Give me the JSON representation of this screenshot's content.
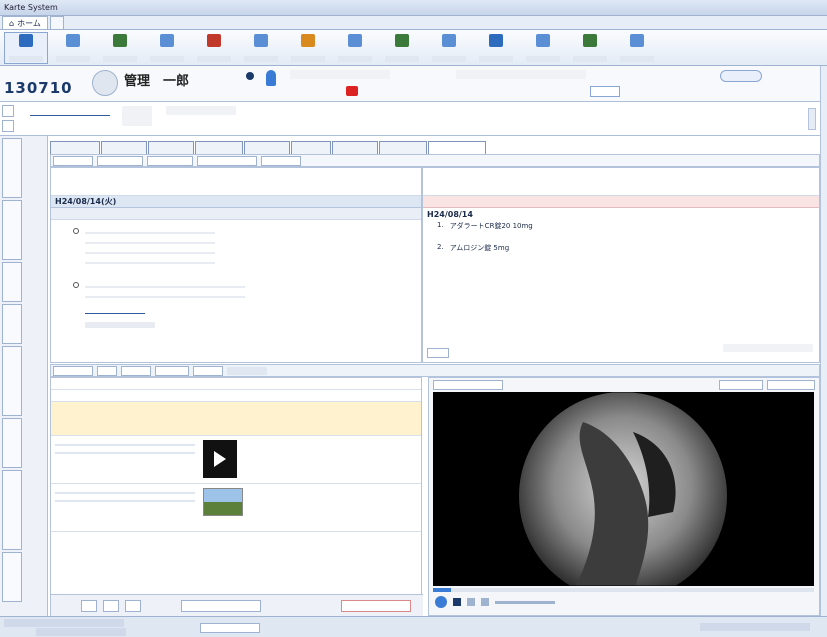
{
  "window": {
    "title": "Karte System"
  },
  "app_tabs": [
    {
      "label": "ホーム"
    }
  ],
  "ribbon": {
    "buttons": [
      {
        "label": "",
        "color": "#2d6bbf"
      },
      {
        "label": "",
        "color": "#5a8fd6"
      },
      {
        "label": "",
        "color": "#3b7a3b"
      },
      {
        "label": "",
        "color": "#5a8fd6"
      },
      {
        "label": "",
        "color": "#c0392b"
      },
      {
        "label": "",
        "color": "#5a8fd6"
      },
      {
        "label": "",
        "color": "#d98a1e"
      },
      {
        "label": "",
        "color": "#5a8fd6"
      },
      {
        "label": "",
        "color": "#3b7a3b"
      },
      {
        "label": "",
        "color": "#5a8fd6"
      },
      {
        "label": "",
        "color": "#2d6bbf"
      },
      {
        "label": "",
        "color": "#5a8fd6"
      },
      {
        "label": "",
        "color": "#3b7a3b"
      },
      {
        "label": "",
        "color": "#5a8fd6"
      }
    ]
  },
  "patient": {
    "id": "130710",
    "name": "管理　一郎"
  },
  "chart_tabs": [],
  "entry": {
    "date": "H24/08/14(火)",
    "notes": []
  },
  "order": {
    "date": "H24/08/14",
    "rows": [
      {
        "name": "アダラートCR錠20 10mg",
        "qty": ""
      },
      {
        "name": "アムロジン錠 5mg",
        "qty": ""
      }
    ]
  },
  "files": {
    "items": [
      {
        "title": "",
        "kind": "video"
      },
      {
        "title": "",
        "kind": "image"
      }
    ]
  }
}
